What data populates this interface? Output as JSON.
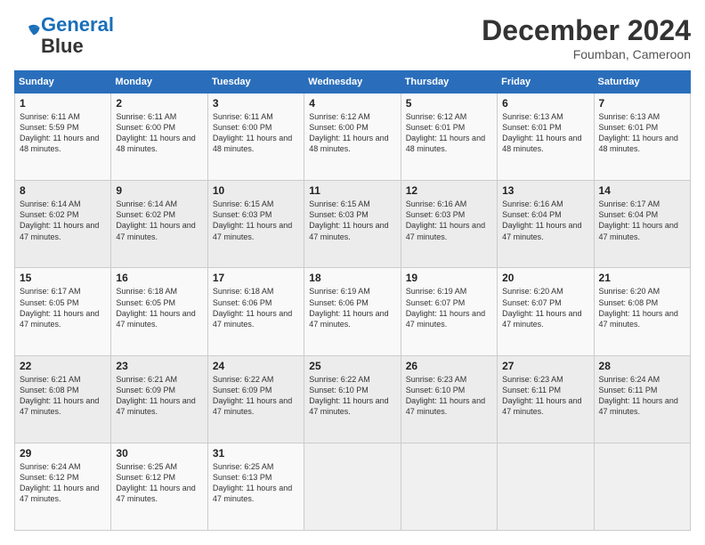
{
  "header": {
    "logo_line1": "General",
    "logo_line2": "Blue",
    "month_year": "December 2024",
    "location": "Foumban, Cameroon"
  },
  "weekdays": [
    "Sunday",
    "Monday",
    "Tuesday",
    "Wednesday",
    "Thursday",
    "Friday",
    "Saturday"
  ],
  "weeks": [
    [
      {
        "day": "1",
        "sunrise": "6:11 AM",
        "sunset": "5:59 PM",
        "daylight": "11 hours and 48 minutes."
      },
      {
        "day": "2",
        "sunrise": "6:11 AM",
        "sunset": "6:00 PM",
        "daylight": "11 hours and 48 minutes."
      },
      {
        "day": "3",
        "sunrise": "6:11 AM",
        "sunset": "6:00 PM",
        "daylight": "11 hours and 48 minutes."
      },
      {
        "day": "4",
        "sunrise": "6:12 AM",
        "sunset": "6:00 PM",
        "daylight": "11 hours and 48 minutes."
      },
      {
        "day": "5",
        "sunrise": "6:12 AM",
        "sunset": "6:01 PM",
        "daylight": "11 hours and 48 minutes."
      },
      {
        "day": "6",
        "sunrise": "6:13 AM",
        "sunset": "6:01 PM",
        "daylight": "11 hours and 48 minutes."
      },
      {
        "day": "7",
        "sunrise": "6:13 AM",
        "sunset": "6:01 PM",
        "daylight": "11 hours and 48 minutes."
      }
    ],
    [
      {
        "day": "8",
        "sunrise": "6:14 AM",
        "sunset": "6:02 PM",
        "daylight": "11 hours and 47 minutes."
      },
      {
        "day": "9",
        "sunrise": "6:14 AM",
        "sunset": "6:02 PM",
        "daylight": "11 hours and 47 minutes."
      },
      {
        "day": "10",
        "sunrise": "6:15 AM",
        "sunset": "6:03 PM",
        "daylight": "11 hours and 47 minutes."
      },
      {
        "day": "11",
        "sunrise": "6:15 AM",
        "sunset": "6:03 PM",
        "daylight": "11 hours and 47 minutes."
      },
      {
        "day": "12",
        "sunrise": "6:16 AM",
        "sunset": "6:03 PM",
        "daylight": "11 hours and 47 minutes."
      },
      {
        "day": "13",
        "sunrise": "6:16 AM",
        "sunset": "6:04 PM",
        "daylight": "11 hours and 47 minutes."
      },
      {
        "day": "14",
        "sunrise": "6:17 AM",
        "sunset": "6:04 PM",
        "daylight": "11 hours and 47 minutes."
      }
    ],
    [
      {
        "day": "15",
        "sunrise": "6:17 AM",
        "sunset": "6:05 PM",
        "daylight": "11 hours and 47 minutes."
      },
      {
        "day": "16",
        "sunrise": "6:18 AM",
        "sunset": "6:05 PM",
        "daylight": "11 hours and 47 minutes."
      },
      {
        "day": "17",
        "sunrise": "6:18 AM",
        "sunset": "6:06 PM",
        "daylight": "11 hours and 47 minutes."
      },
      {
        "day": "18",
        "sunrise": "6:19 AM",
        "sunset": "6:06 PM",
        "daylight": "11 hours and 47 minutes."
      },
      {
        "day": "19",
        "sunrise": "6:19 AM",
        "sunset": "6:07 PM",
        "daylight": "11 hours and 47 minutes."
      },
      {
        "day": "20",
        "sunrise": "6:20 AM",
        "sunset": "6:07 PM",
        "daylight": "11 hours and 47 minutes."
      },
      {
        "day": "21",
        "sunrise": "6:20 AM",
        "sunset": "6:08 PM",
        "daylight": "11 hours and 47 minutes."
      }
    ],
    [
      {
        "day": "22",
        "sunrise": "6:21 AM",
        "sunset": "6:08 PM",
        "daylight": "11 hours and 47 minutes."
      },
      {
        "day": "23",
        "sunrise": "6:21 AM",
        "sunset": "6:09 PM",
        "daylight": "11 hours and 47 minutes."
      },
      {
        "day": "24",
        "sunrise": "6:22 AM",
        "sunset": "6:09 PM",
        "daylight": "11 hours and 47 minutes."
      },
      {
        "day": "25",
        "sunrise": "6:22 AM",
        "sunset": "6:10 PM",
        "daylight": "11 hours and 47 minutes."
      },
      {
        "day": "26",
        "sunrise": "6:23 AM",
        "sunset": "6:10 PM",
        "daylight": "11 hours and 47 minutes."
      },
      {
        "day": "27",
        "sunrise": "6:23 AM",
        "sunset": "6:11 PM",
        "daylight": "11 hours and 47 minutes."
      },
      {
        "day": "28",
        "sunrise": "6:24 AM",
        "sunset": "6:11 PM",
        "daylight": "11 hours and 47 minutes."
      }
    ],
    [
      {
        "day": "29",
        "sunrise": "6:24 AM",
        "sunset": "6:12 PM",
        "daylight": "11 hours and 47 minutes."
      },
      {
        "day": "30",
        "sunrise": "6:25 AM",
        "sunset": "6:12 PM",
        "daylight": "11 hours and 47 minutes."
      },
      {
        "day": "31",
        "sunrise": "6:25 AM",
        "sunset": "6:13 PM",
        "daylight": "11 hours and 47 minutes."
      },
      null,
      null,
      null,
      null
    ]
  ]
}
